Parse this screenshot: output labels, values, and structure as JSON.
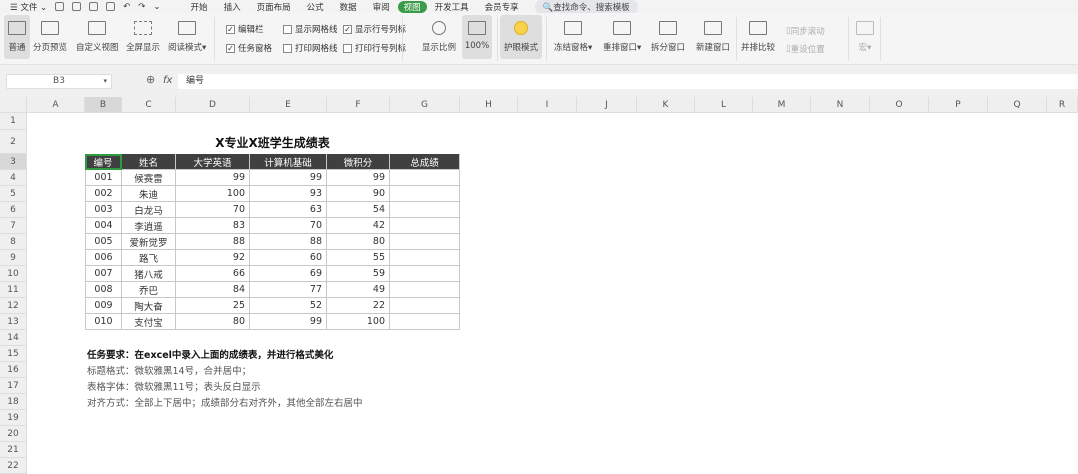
{
  "menubar": {
    "file": "文件",
    "tabs": [
      "开始",
      "插入",
      "页面布局",
      "公式",
      "数据",
      "审阅",
      "视图",
      "开发工具",
      "会员专享"
    ],
    "active_tab": "视图",
    "search_placeholder": "查找命令、搜索模板"
  },
  "ribbon": {
    "buttons": [
      "普通",
      "分页预览",
      "自定义视图",
      "全屏显示",
      "阅读模式"
    ],
    "checkboxes": [
      {
        "label": "编辑栏",
        "checked": true
      },
      {
        "label": "任务窗格",
        "checked": true
      },
      {
        "label": "显示网格线",
        "checked": false
      },
      {
        "label": "打印网格线",
        "checked": false
      },
      {
        "label": "显示行号列标",
        "checked": true
      },
      {
        "label": "打印行号列标",
        "checked": false
      }
    ],
    "zoom_buttons": [
      "显示比例",
      "100%"
    ],
    "eye_mode": "护眼模式",
    "window_buttons": [
      "冻结窗格",
      "重排窗口",
      "拆分窗口",
      "新建窗口",
      "并排比较"
    ],
    "disabled": [
      "同步滚动",
      "重设位置",
      "宏"
    ]
  },
  "formula_bar": {
    "cell_ref": "B3",
    "fx": "fx",
    "value": "编号"
  },
  "columns": [
    "A",
    "B",
    "C",
    "D",
    "E",
    "F",
    "G",
    "H",
    "I",
    "J",
    "K",
    "L",
    "M",
    "N",
    "O",
    "P",
    "Q",
    "R"
  ],
  "selected_cell": "B3",
  "sheet": {
    "title": "X专业X班学生成绩表",
    "headers": [
      "编号",
      "姓名",
      "大学英语",
      "计算机基础",
      "微积分",
      "总成绩"
    ],
    "rows": [
      [
        "001",
        "候赛雷",
        "99",
        "99",
        "99",
        ""
      ],
      [
        "002",
        "朱迪",
        "100",
        "93",
        "90",
        ""
      ],
      [
        "003",
        "白龙马",
        "70",
        "63",
        "54",
        ""
      ],
      [
        "004",
        "李逍遥",
        "83",
        "70",
        "42",
        ""
      ],
      [
        "005",
        "爱新觉罗",
        "88",
        "88",
        "80",
        ""
      ],
      [
        "006",
        "路飞",
        "92",
        "60",
        "55",
        ""
      ],
      [
        "007",
        "猪八戒",
        "66",
        "69",
        "59",
        ""
      ],
      [
        "008",
        "乔巴",
        "84",
        "77",
        "49",
        ""
      ],
      [
        "009",
        "陶大奋",
        "25",
        "52",
        "22",
        ""
      ],
      [
        "010",
        "支付宝",
        "80",
        "99",
        "100",
        ""
      ]
    ],
    "notes": [
      "任务要求：在excel中录入上面的成绩表，并进行格式美化",
      "标题格式：微软雅黑14号，合并居中；",
      "表格字体：微软雅黑11号；表头反白显示",
      "对齐方式：全部上下居中；成绩部分右对齐外，其他全部左右居中"
    ]
  }
}
